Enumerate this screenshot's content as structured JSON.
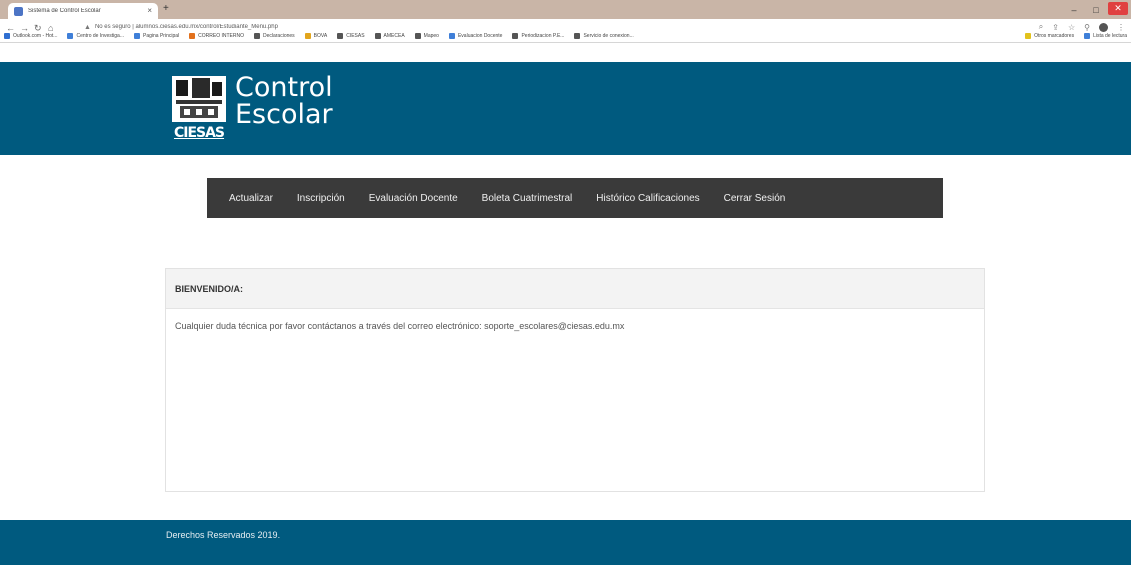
{
  "browser": {
    "tab_title": "Sistema de Control Escolar",
    "tab_close": "×",
    "new_tab": "+",
    "minimize": "–",
    "maximize": "□",
    "close": "✕",
    "url": "No es seguro | alumnos.ciesas.edu.mx/control/Estudiante_Menu.php",
    "bookmarks": [
      {
        "label": "Outlook.com - Hot...",
        "color": "#2f6fd1"
      },
      {
        "label": "Centro de Investiga...",
        "color": "#3f7fd8"
      },
      {
        "label": "Pagina Principal",
        "color": "#3f7fd8"
      },
      {
        "label": "CORREO INTERNO",
        "color": "#e2711d"
      },
      {
        "label": "Declaraciones",
        "color": "#555555"
      },
      {
        "label": "BOVA",
        "color": "#e2a51d"
      },
      {
        "label": "CIESAS",
        "color": "#555555"
      },
      {
        "label": "AMECEA",
        "color": "#555555"
      },
      {
        "label": "Mapeo",
        "color": "#555555"
      },
      {
        "label": "Evaluacion Docente",
        "color": "#3f7fd8"
      },
      {
        "label": "Periodizacion P.E...",
        "color": "#555555"
      },
      {
        "label": "Servicio de conexion...",
        "color": "#555555"
      }
    ],
    "bookmarks_right": [
      {
        "label": "Otros marcadores",
        "color": "#e2c21d"
      },
      {
        "label": "Lista de lectura",
        "color": "#3f7fd8"
      }
    ]
  },
  "header": {
    "logo_line1": "Control",
    "logo_line2": "Escolar",
    "logo_org": "CIESAS"
  },
  "nav": {
    "items": [
      "Actualizar",
      "Inscripción",
      "Evaluación Docente",
      "Boleta Cuatrimestral",
      "Histórico Calificaciones",
      "Cerrar Sesión"
    ]
  },
  "panel": {
    "heading": "BIENVENIDO/A:",
    "body": "Cualquier duda técnica por favor contáctanos a través del correo electrónico: soporte_escolares@ciesas.edu.mx"
  },
  "footer": {
    "text": "Derechos Reservados 2019."
  },
  "colors": {
    "brand_blue": "#005a7f",
    "nav_dark": "#3a3a3a"
  }
}
